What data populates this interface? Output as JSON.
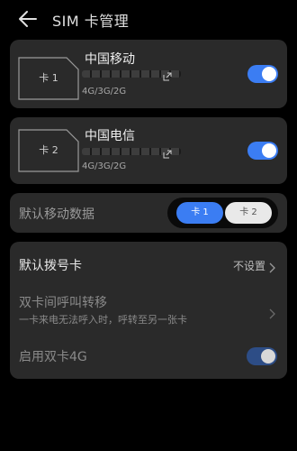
{
  "header": {
    "title": "SIM 卡管理",
    "back_icon": "arrow-left-icon"
  },
  "sims": [
    {
      "slot_label": "卡 1",
      "carrier": "中国移动",
      "network": "4G/3G/2G",
      "enabled": true
    },
    {
      "slot_label": "卡 2",
      "carrier": "中国电信",
      "network": "4G/3G/2G",
      "enabled": true
    }
  ],
  "mobile_data": {
    "label": "默认移动数据",
    "options": [
      "卡 1",
      "卡 2"
    ],
    "selected": "卡 1"
  },
  "default_dial": {
    "label": "默认拨号卡",
    "value": "不设置"
  },
  "call_forward": {
    "title": "双卡间呼叫转移",
    "subtitle": "一卡来电无法呼入时，呼转至另一张卡"
  },
  "dual_4g": {
    "label": "启用双卡4G",
    "enabled": true
  },
  "colors": {
    "accent": "#3b7df3",
    "background": "#000000",
    "card": "#2a2a2a"
  }
}
